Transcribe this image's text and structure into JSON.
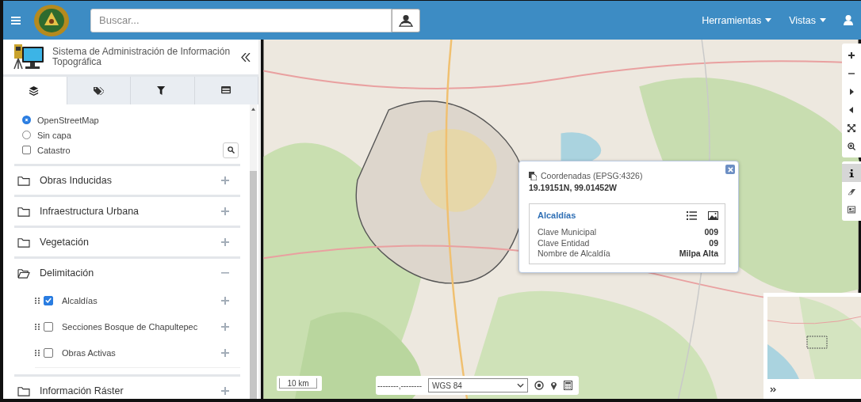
{
  "header": {
    "search_placeholder": "Buscar...",
    "menus": [
      {
        "label": "Herramientas"
      },
      {
        "label": "Vistas"
      }
    ]
  },
  "sidebar": {
    "title": "Sistema de Administración de Información Topográfica",
    "tabs": [
      {
        "kind": "layers",
        "selected": true
      },
      {
        "kind": "tags",
        "selected": false
      },
      {
        "kind": "filter",
        "selected": false
      },
      {
        "kind": "table",
        "selected": false
      }
    ],
    "base_layers": [
      {
        "kind": "radio",
        "label": "OpenStreetMap",
        "checked": true
      },
      {
        "kind": "radio",
        "label": "Sin capa",
        "checked": false
      },
      {
        "kind": "checkbox",
        "label": "Catastro",
        "checked": false
      }
    ],
    "groups": [
      {
        "label": "Obras Inducidas",
        "expanded": false
      },
      {
        "label": "Infraestructura Urbana",
        "expanded": false
      },
      {
        "label": "Vegetación",
        "expanded": false
      },
      {
        "label": "Delimitación",
        "expanded": true,
        "layers": [
          {
            "label": "Alcaldías",
            "checked": true
          },
          {
            "label": "Secciones Bosque de Chapultepec",
            "checked": false
          },
          {
            "label": "Obras Activas",
            "checked": false
          }
        ]
      },
      {
        "label": "Información Ráster",
        "expanded": false
      }
    ]
  },
  "map": {
    "popup": {
      "title": "Coordenadas (EPSG:4326)",
      "coordinates": "19.19151N, 99.01452W",
      "layer": "Alcaldías",
      "fields": [
        {
          "name": "Clave Municipal",
          "value": "009"
        },
        {
          "name": "Clave Entidad",
          "value": "09"
        },
        {
          "name": "Nombre de Alcaldía",
          "value": "Milpa Alta"
        }
      ]
    },
    "tools": [
      {
        "kind": "zoom-in",
        "selected": false
      },
      {
        "kind": "zoom-out",
        "selected": false
      },
      {
        "kind": "forward",
        "selected": false
      },
      {
        "kind": "back",
        "selected": false
      },
      {
        "kind": "extent",
        "selected": false
      },
      {
        "kind": "zoom-box",
        "selected": false
      }
    ],
    "tools_2": [
      {
        "kind": "info",
        "selected": true
      },
      {
        "kind": "eraser",
        "selected": false
      },
      {
        "kind": "card",
        "selected": false
      }
    ],
    "scale": "10 km",
    "coordinate_input": "--------,--------",
    "projection": "WGS 84"
  }
}
